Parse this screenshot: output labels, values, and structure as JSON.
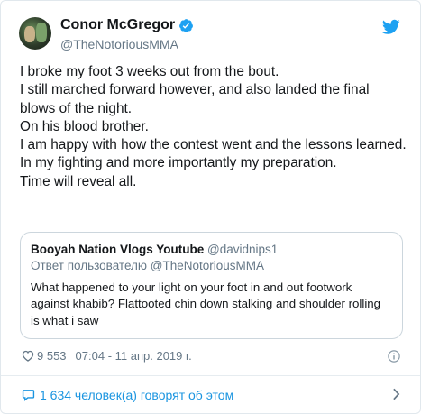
{
  "author": {
    "name": "Conor McGregor",
    "handle": "@TheNotoriousMMA"
  },
  "tweet": {
    "lines": [
      "I broke my foot 3 weeks out from the bout.",
      "I still marched forward however, and also landed the final blows of the night.",
      "On his blood brother.",
      "I am happy with how the contest went and the lessons learned.",
      "In my fighting and more importantly my preparation.",
      "Time will reveal all."
    ]
  },
  "quote": {
    "name": "Booyah Nation Vlogs Youtube",
    "handle": "@davidnips1",
    "reply_to": "Ответ пользователю @TheNotoriousMMA",
    "text": "What happened to your light on your foot in and out footwork against khabib? Flattooted chin down stalking and shoulder rolling is what i saw"
  },
  "meta": {
    "likes": "9 553",
    "timestamp": "07:04 - 11 апр. 2019 г."
  },
  "footer": {
    "talking_label": "1 634 человек(а) говорят об этом"
  },
  "colors": {
    "accent": "#1b95e0",
    "secondary_text": "#657786",
    "border": "#e1e8ed"
  }
}
